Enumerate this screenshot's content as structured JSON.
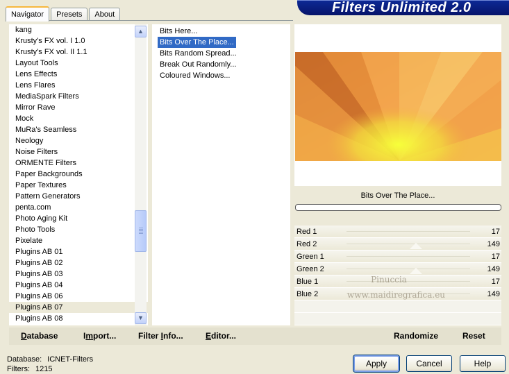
{
  "tabs": [
    "Navigator",
    "Presets",
    "About"
  ],
  "brand": {
    "title": "Filters Unlimited 2.0"
  },
  "categories": [
    "kang",
    "Krusty's FX vol. I 1.0",
    "Krusty's FX vol. II 1.1",
    "Layout Tools",
    "Lens Effects",
    "Lens Flares",
    "MediaSpark Filters",
    "Mirror Rave",
    "Mock",
    "MuRa's Seamless",
    "Neology",
    "Noise Filters",
    "ORMENTE Filters",
    "Paper Backgrounds",
    "Paper Textures",
    "Pattern Generators",
    "penta.com",
    "Photo Aging Kit",
    "Photo Tools",
    "Pixelate",
    "Plugins AB 01",
    "Plugins AB 02",
    "Plugins AB 03",
    "Plugins AB 04",
    "Plugins AB 06",
    "Plugins AB 07",
    "Plugins AB 08"
  ],
  "selected_category": "Plugins AB 07",
  "filters": [
    "Bits Here...",
    "Bits Over The Place...",
    "Bits Random Spread...",
    "Break Out Randomly...",
    "Coloured Windows..."
  ],
  "selected_filter": "Bits Over The Place...",
  "preview": {
    "filter_title": "Bits Over The Place...",
    "progress": 0
  },
  "params": [
    {
      "label": "Red 1",
      "value": "17"
    },
    {
      "label": "Red 2",
      "value": "149"
    },
    {
      "label": "Green 1",
      "value": "17"
    },
    {
      "label": "Green 2",
      "value": "149"
    },
    {
      "label": "Blue 1",
      "value": "17"
    },
    {
      "label": "Blue 2",
      "value": "149"
    }
  ],
  "watermark": {
    "line1": "Pinuccia",
    "line2": "www.maidiregrafica.eu"
  },
  "toolbar": {
    "database_u": "D",
    "database_rest": "atabase",
    "import_pre": "I",
    "import_u": "m",
    "import_rest": "port...",
    "filterinfo_pre": "Filter ",
    "filterinfo_u": "I",
    "filterinfo_rest": "nfo...",
    "editor_u": "E",
    "editor_rest": "ditor...",
    "randomize": "Randomize",
    "reset": "Reset"
  },
  "info": {
    "database_label": "Database:",
    "database_value": "ICNET-Filters",
    "filters_label": "Filters:",
    "filters_value": "1215"
  },
  "buttons": {
    "apply": "Apply",
    "cancel": "Cancel",
    "help": "Help"
  }
}
